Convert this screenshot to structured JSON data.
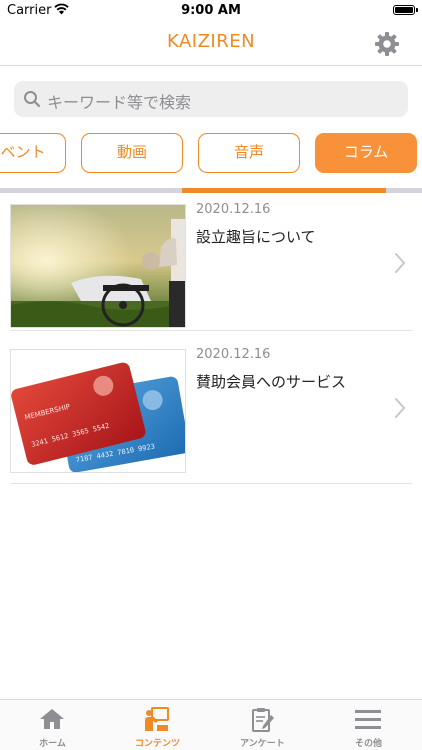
{
  "status_bar": {
    "carrier": "Carrier",
    "time": "9:00 AM"
  },
  "nav": {
    "title": "KAIZIREN",
    "settings_icon": "gear-icon"
  },
  "search": {
    "placeholder": "キーワード等で検索",
    "icon": "search-icon"
  },
  "segments": [
    {
      "label": "ベント",
      "active": false
    },
    {
      "label": "動画",
      "active": false
    },
    {
      "label": "音声",
      "active": false
    },
    {
      "label": "コラム",
      "active": true
    }
  ],
  "items": [
    {
      "date": "2020.12.16",
      "title": "設立趣旨について",
      "image": "wheelchair-photo"
    },
    {
      "date": "2020.12.16",
      "title": "賛助会員へのサービス",
      "image": "membership-card-photo",
      "card_text": {
        "red_label": "MEMBERSHIP",
        "red_number": "3241 5612 3565 5542",
        "blue_number": "7187 4432 7810 9923"
      }
    }
  ],
  "tabs": [
    {
      "label": "ホーム",
      "icon": "home-icon",
      "active": false
    },
    {
      "label": "コンテンツ",
      "icon": "contents-icon",
      "active": true
    },
    {
      "label": "アンケート",
      "icon": "survey-icon",
      "active": false
    },
    {
      "label": "その他",
      "icon": "menu-icon",
      "active": false
    }
  ],
  "colors": {
    "accent": "#f08a24",
    "accent_fill": "#f7923a",
    "inactive": "#8e8e93"
  }
}
